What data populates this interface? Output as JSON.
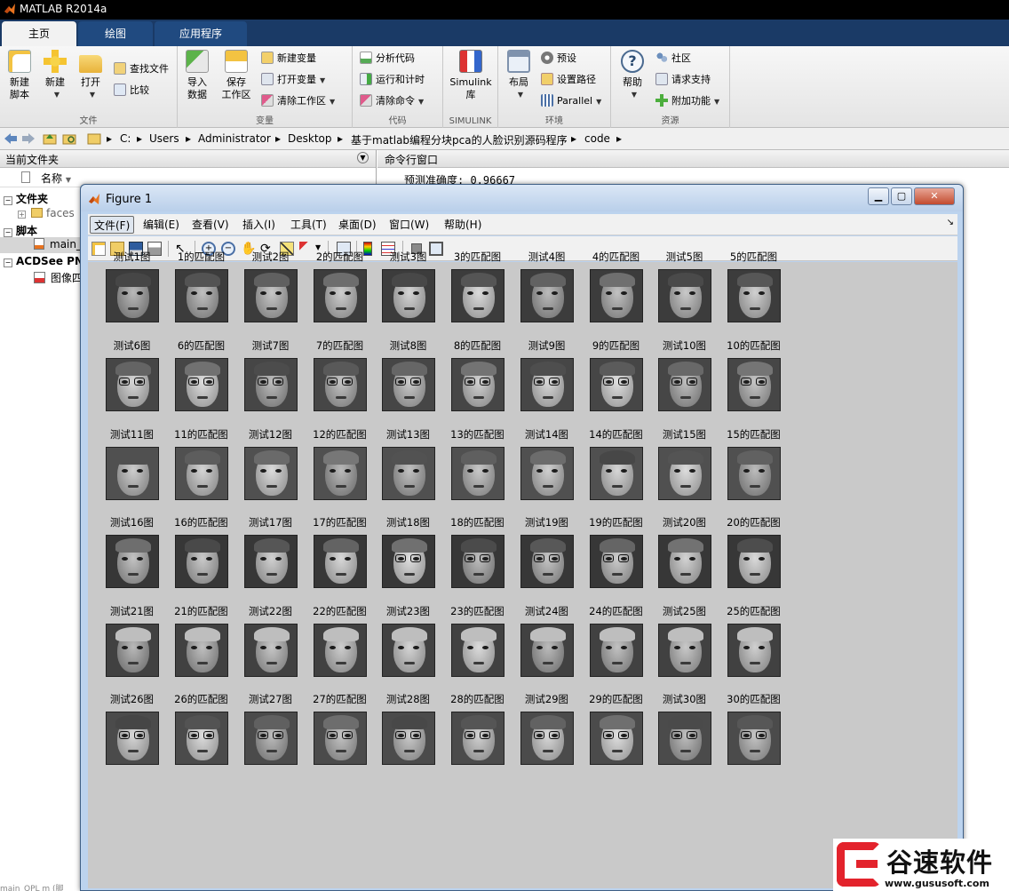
{
  "app": {
    "title": "MATLAB R2014a"
  },
  "tabs": [
    {
      "label": "主页"
    },
    {
      "label": "绘图"
    },
    {
      "label": "应用程序"
    }
  ],
  "ribbon": {
    "file_group": {
      "label": "文件",
      "new_script": "新建\n脚本",
      "new": "新建",
      "open": "打开",
      "find_files": "查找文件",
      "compare": "比较"
    },
    "variable_group": {
      "label": "变量",
      "import": "导入\n数据",
      "save_ws": "保存\n工作区",
      "new_var": "新建变量",
      "open_var": "打开变量",
      "clear_ws": "清除工作区"
    },
    "code_group": {
      "label": "代码",
      "analyze": "分析代码",
      "run_time": "运行和计时",
      "clear_cmd": "清除命令"
    },
    "simulink_group": {
      "label": "SIMULINK",
      "simulink": "Simulink\n库"
    },
    "env_group": {
      "label": "环境",
      "layout": "布局",
      "prefs": "预设",
      "set_path": "设置路径",
      "parallel": "Parallel"
    },
    "resources_group": {
      "label": "资源",
      "help": "帮助",
      "community": "社区",
      "support": "请求支持",
      "addons": "附加功能"
    }
  },
  "address": {
    "path": [
      "C:",
      "Users",
      "Administrator",
      "Desktop",
      "基于matlab编程分块pca的人脸识别源码程序",
      "code"
    ]
  },
  "left_panel": {
    "title": "当前文件夹",
    "name_col": "名称",
    "tree": [
      {
        "label": "文件夹",
        "bold": true
      },
      {
        "label": "faces"
      },
      {
        "label": "脚本",
        "bold": true
      },
      {
        "label": "main_"
      },
      {
        "label": "ACDSee PN",
        "bold": true
      },
      {
        "label": "图像四"
      }
    ],
    "bottom_file": "main_QPL m (脚"
  },
  "command": {
    "title": "命令行窗口",
    "output": "预测准确度: 0.96667"
  },
  "figure": {
    "title": "Figure 1",
    "menus": [
      "文件(F)",
      "编辑(E)",
      "查看(V)",
      "插入(I)",
      "工具(T)",
      "桌面(D)",
      "窗口(W)",
      "帮助(H)"
    ],
    "toolbar_icons": [
      "new-figure-icon",
      "open-file-icon",
      "save-icon",
      "print-icon",
      "pointer-icon",
      "zoom-in-icon",
      "zoom-out-icon",
      "pan-hand-icon",
      "rotate-3d-icon",
      "data-cursor-icon",
      "brush-icon",
      "link-plot-icon",
      "colorbar-icon",
      "legend-icon",
      "hide-tools-icon",
      "show-tools-icon"
    ],
    "captions": [
      "测试1图",
      "1的匹配图",
      "测试2图",
      "2的匹配图",
      "测试3图",
      "3的匹配图",
      "测试4图",
      "4的匹配图",
      "测试5图",
      "5的匹配图",
      "测试6图",
      "6的匹配图",
      "测试7图",
      "7的匹配图",
      "测试8图",
      "8的匹配图",
      "测试9图",
      "9的匹配图",
      "测试10图",
      "10的匹配图",
      "测试11图",
      "11的匹配图",
      "测试12图",
      "12的匹配图",
      "测试13图",
      "13的匹配图",
      "测试14图",
      "14的匹配图",
      "测试15图",
      "15的匹配图",
      "测试16图",
      "16的匹配图",
      "测试17图",
      "17的匹配图",
      "测试18图",
      "18的匹配图",
      "测试19图",
      "19的匹配图",
      "测试20图",
      "20的匹配图",
      "测试21图",
      "21的匹配图",
      "测试22图",
      "22的匹配图",
      "测试23图",
      "23的匹配图",
      "测试24图",
      "24的匹配图",
      "测试25图",
      "25的匹配图",
      "测试26图",
      "26的匹配图",
      "测试27图",
      "27的匹配图",
      "测试28图",
      "28的匹配图",
      "测试29图",
      "29的匹配图",
      "测试30图",
      "30的匹配图"
    ]
  },
  "watermark": {
    "brand": "谷速软件",
    "url": "www.gususoft.com"
  },
  "colors": {
    "matlab_tab_bg": "#1a3a66",
    "figure_bg": "#c9c9c9",
    "watermark_red": "#e3232c"
  }
}
